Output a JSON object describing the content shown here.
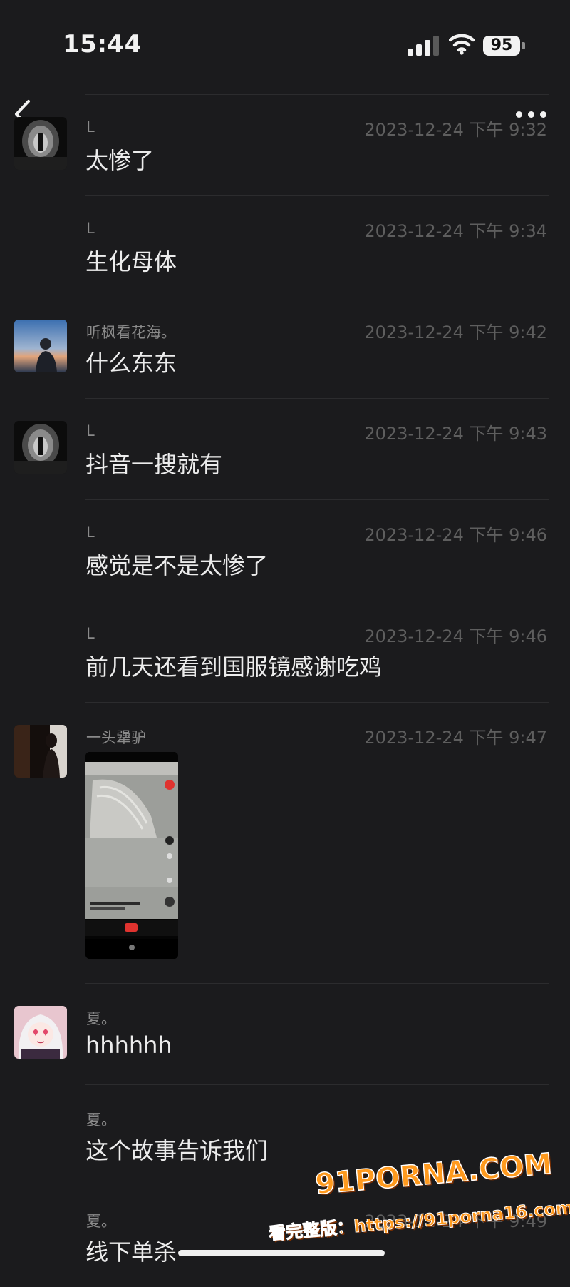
{
  "status_bar": {
    "time": "15:44",
    "battery": "95",
    "signal_icon": "cellular-signal-icon",
    "wifi_icon": "wifi-icon"
  },
  "header": {
    "back_icon": "chevron-left-icon",
    "more_icon": "more-dots-icon"
  },
  "messages": [
    {
      "sender": "L",
      "time": "2023-12-24 下午 9:32",
      "text": "太惨了",
      "avatar": "tunnel-figure"
    },
    {
      "sender": "L",
      "time": "2023-12-24 下午 9:34",
      "text": "生化母体",
      "avatar": ""
    },
    {
      "sender": "听枫看花海。",
      "time": "2023-12-24 下午 9:42",
      "text": "什么东东",
      "avatar": "sunset-person"
    },
    {
      "sender": "L",
      "time": "2023-12-24 下午 9:43",
      "text": "抖音一搜就有",
      "avatar": "tunnel-figure"
    },
    {
      "sender": "L",
      "time": "2023-12-24 下午 9:46",
      "text": "感觉是不是太惨了",
      "avatar": ""
    },
    {
      "sender": "L",
      "time": "2023-12-24 下午 9:46",
      "text": "前几天还看到国服镜感谢吃鸡",
      "avatar": ""
    },
    {
      "sender": "一头犟驴",
      "time": "2023-12-24 下午 9:47",
      "text": "",
      "image": "phone-screenshot-thumbnail",
      "avatar": "dark-silhouette"
    },
    {
      "sender": "夏。",
      "time": "",
      "text": "hhhhhh",
      "avatar": "anime-girl"
    },
    {
      "sender": "夏。",
      "time": "",
      "text": "这个故事告诉我们",
      "avatar": ""
    },
    {
      "sender": "夏。",
      "time": "2023-12-24 下午 9:49",
      "text": "线下单杀",
      "avatar": ""
    }
  ],
  "watermark": {
    "logo": "91PORNA.COM",
    "subtitle": "看完整版：https://91porna16.com"
  },
  "colors": {
    "background": "#1b1b1d",
    "text": "#ececec",
    "meta": "#5e5e5e",
    "watermark": "#ff9a1e"
  }
}
